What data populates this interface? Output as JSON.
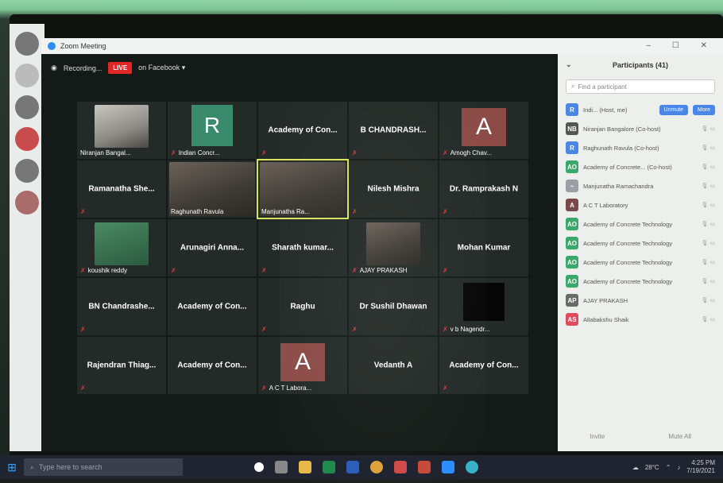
{
  "window": {
    "title": "Zoom Meeting",
    "controls": "–  ☐  ✕"
  },
  "recording": {
    "text": "Recording...",
    "live_badge": "LIVE",
    "live_target": "on Facebook ▾"
  },
  "tiles": [
    {
      "type": "video",
      "label": "Niranjan Bangal...",
      "muted": false,
      "style": "light"
    },
    {
      "type": "letter-r",
      "avatar": "R",
      "label": "Indian Concr...",
      "muted": true
    },
    {
      "type": "name",
      "name": "Academy of Con...",
      "muted": true
    },
    {
      "type": "name",
      "name": "B CHANDRASH...",
      "muted": true
    },
    {
      "type": "avatar",
      "avatar": "A",
      "label": "Amogh Chav...",
      "muted": true
    },
    {
      "type": "name",
      "name": "Ramanatha She...",
      "muted": true
    },
    {
      "type": "video-wide",
      "label": "Raghunath Ravula",
      "muted": false
    },
    {
      "type": "video-wide",
      "label": "Manjunatha Ra...",
      "muted": false,
      "active": true
    },
    {
      "type": "name",
      "name": "Nilesh Mishra",
      "muted": true
    },
    {
      "type": "name",
      "name": "Dr. Ramprakash N",
      "muted": true
    },
    {
      "type": "video",
      "label": "koushik reddy",
      "muted": true,
      "style": "green"
    },
    {
      "type": "name",
      "name": "Arunagiri Anna...",
      "muted": true
    },
    {
      "type": "name",
      "name": "Sharath kumar...",
      "muted": true
    },
    {
      "type": "video",
      "label": "AJAY PRAKASH",
      "muted": true
    },
    {
      "type": "name",
      "name": "Mohan Kumar",
      "muted": true
    },
    {
      "type": "name",
      "name": "BN Chandrashe...",
      "muted": true
    },
    {
      "type": "name",
      "name": "Academy of Con...",
      "muted": false
    },
    {
      "type": "name",
      "name": "Raghu",
      "muted": true
    },
    {
      "type": "name",
      "name": "Dr Sushil Dhawan",
      "muted": true
    },
    {
      "type": "blackbox",
      "label": "v b Nagendr...",
      "muted": true
    },
    {
      "type": "name",
      "name": "Rajendran Thiag...",
      "muted": true
    },
    {
      "type": "name",
      "name": "Academy of Con...",
      "muted": false
    },
    {
      "type": "avatar",
      "avatar": "A",
      "label": "A C T Labora...",
      "muted": true
    },
    {
      "type": "name",
      "name": "Vedanth A",
      "muted": false
    },
    {
      "type": "name",
      "name": "Academy of Con...",
      "muted": true
    }
  ],
  "participants": {
    "title": "Participants (41)",
    "search_placeholder": "Find a participant",
    "unmute_label": "Unmute",
    "more_label": "More",
    "invite_label": "Invite",
    "mute_all_label": "Mute All",
    "list": [
      {
        "initials": "R",
        "name": "Indi... (Host, me)",
        "color": "#4a86e8"
      },
      {
        "initials": "NB",
        "name": "Niranjan Bangalore (Co-host)",
        "color": "#555555"
      },
      {
        "initials": "R",
        "name": "Raghunath Ravula (Co-host)",
        "color": "#4a86e8"
      },
      {
        "initials": "AO",
        "name": "Academy of Concrete... (Co-host)",
        "color": "#3aa86a"
      },
      {
        "initials": "~",
        "name": "Manjunatha Ramachandra",
        "color": "#9aa0a6"
      },
      {
        "initials": "A",
        "name": "A C T Laboratory",
        "color": "#7a4a4a"
      },
      {
        "initials": "AO",
        "name": "Academy of Concrete Technology",
        "color": "#3aa86a"
      },
      {
        "initials": "AO",
        "name": "Academy of Concrete Technology",
        "color": "#3aa86a"
      },
      {
        "initials": "AO",
        "name": "Academy of Concrete Technology",
        "color": "#3aa86a"
      },
      {
        "initials": "AO",
        "name": "Academy of Concrete Technology",
        "color": "#3aa86a"
      },
      {
        "initials": "AP",
        "name": "AJAY PRAKASH",
        "color": "#6a6a6a"
      },
      {
        "initials": "AS",
        "name": "Allabakshu Shaik",
        "color": "#e04a5a"
      }
    ]
  },
  "taskbar": {
    "search_placeholder": "Type here to search",
    "weather": "28°C",
    "time": "4:25 PM",
    "date": "7/19/2021"
  },
  "colors": {
    "accent": "#2d8cff",
    "live": "#e02727",
    "active_speaker": "#d7e35a"
  }
}
